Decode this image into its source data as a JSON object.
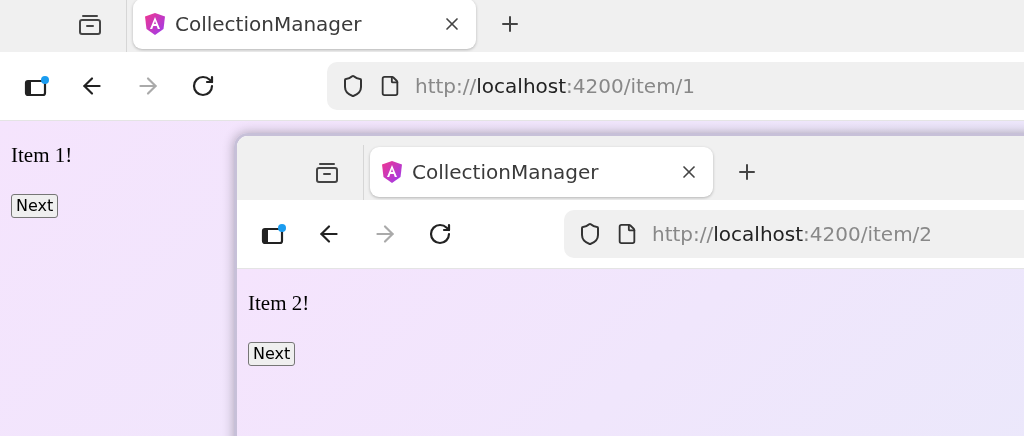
{
  "windows": [
    {
      "tab": {
        "title": "CollectionManager",
        "selected": true
      },
      "url": {
        "scheme": "http://",
        "host": "localhost",
        "path": ":4200/item/1"
      },
      "forward_disabled": true,
      "page": {
        "heading": "Item 1!",
        "button": "Next"
      }
    },
    {
      "tab": {
        "title": "CollectionManager",
        "selected": true
      },
      "url": {
        "scheme": "http://",
        "host": "localhost",
        "path": ":4200/item/2"
      },
      "forward_disabled": true,
      "page": {
        "heading": "Item 2!",
        "button": "Next"
      }
    }
  ]
}
